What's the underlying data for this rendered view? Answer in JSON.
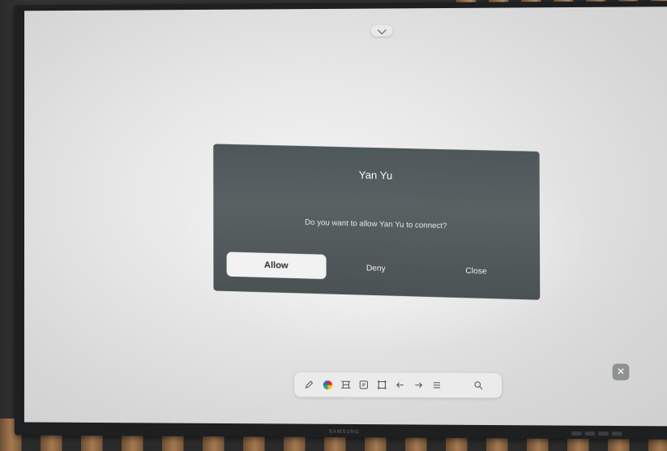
{
  "dialog": {
    "title": "Yan Yu",
    "message": "Do you want to allow Yan Yu to connect?",
    "buttons": {
      "allow": "Allow",
      "deny": "Deny",
      "close": "Close"
    }
  },
  "top_handle": {
    "icon": "chevron-down-icon"
  },
  "toolbar": {
    "tools": [
      {
        "name": "pen-icon"
      },
      {
        "name": "color-picker-icon"
      },
      {
        "name": "eraser-icon"
      },
      {
        "name": "sticky-note-icon"
      },
      {
        "name": "select-area-icon"
      },
      {
        "name": "undo-icon"
      },
      {
        "name": "redo-icon"
      },
      {
        "name": "menu-icon"
      },
      {
        "name": "search-icon"
      }
    ]
  },
  "close_overlay": {
    "icon": "close-icon"
  },
  "colors": {
    "dialog_bg": "#535b5d",
    "screen_bg": "#e6e6e6",
    "primary_button_bg": "#f2f2f2"
  }
}
